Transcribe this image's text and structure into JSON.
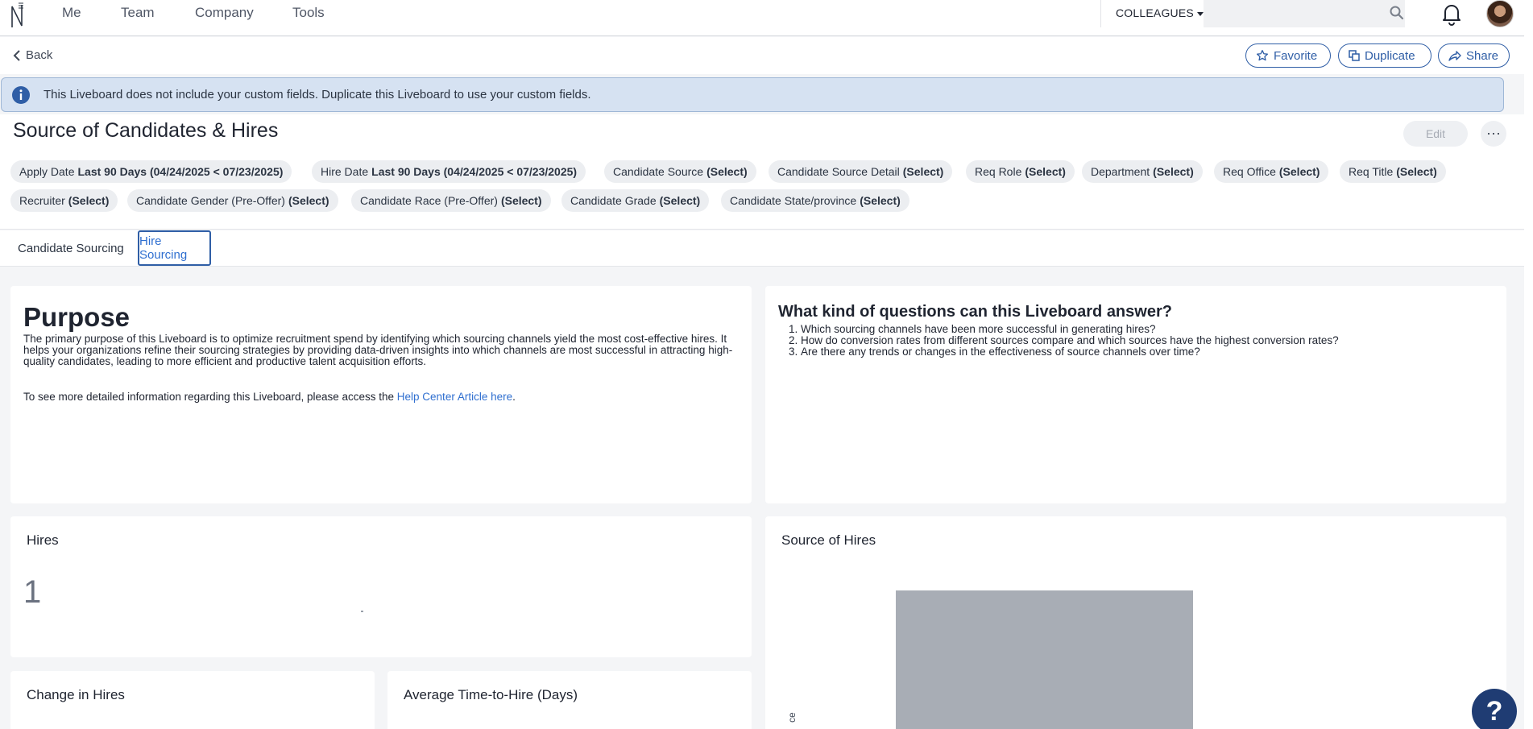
{
  "nav": {
    "items": [
      "Me",
      "Team",
      "Company",
      "Tools"
    ],
    "colleagues_label": "COLLEAGUES",
    "search_placeholder": ""
  },
  "subbar": {
    "back_label": "Back",
    "favorite_label": "Favorite",
    "duplicate_label": "Duplicate",
    "share_label": "Share"
  },
  "banner": {
    "text": "This Liveboard does not include your custom fields. Duplicate this Liveboard to use your custom fields."
  },
  "page": {
    "title": "Source of Candidates & Hires",
    "edit_label": "Edit",
    "more_label": "⋯"
  },
  "filters": [
    {
      "name": "Apply Date",
      "value": "Last 90 Days (04/24/2025 < 07/23/2025)"
    },
    {
      "name": "Hire Date",
      "value": "Last 90 Days (04/24/2025 < 07/23/2025)"
    },
    {
      "name": "Candidate Source",
      "value": "(Select)"
    },
    {
      "name": "Candidate Source Detail",
      "value": "(Select)"
    },
    {
      "name": "Req Role",
      "value": "(Select)"
    },
    {
      "name": "Department",
      "value": "(Select)"
    },
    {
      "name": "Req Office",
      "value": "(Select)"
    },
    {
      "name": "Req Title",
      "value": "(Select)"
    },
    {
      "name": "Recruiter",
      "value": "(Select)"
    },
    {
      "name": "Candidate Gender (Pre-Offer)",
      "value": "(Select)"
    },
    {
      "name": "Candidate Race (Pre-Offer)",
      "value": "(Select)"
    },
    {
      "name": "Candidate Grade",
      "value": "(Select)"
    },
    {
      "name": "Candidate State/province",
      "value": "(Select)"
    }
  ],
  "tabs": [
    {
      "label": "Candidate Sourcing",
      "active": false
    },
    {
      "label": "Hire Sourcing",
      "active": true
    }
  ],
  "purpose": {
    "heading": "Purpose",
    "description": "The primary purpose of this Liveboard is to optimize recruitment spend by identifying which sourcing channels yield the most cost-effective hires. It helps your organizations refine their sourcing strategies by providing data-driven insights into which channels are most successful in attracting high-quality candidates, leading to more efficient and productive talent acquisition efforts.",
    "more_prefix": "To see more detailed information regarding this Liveboard, please access the ",
    "link_text": "Help Center Article here",
    "more_suffix": "."
  },
  "questions": {
    "heading": "What kind of questions can this Liveboard answer?",
    "items": [
      "Which sourcing channels have been more successful in generating hires?",
      "How do conversion rates from different sources compare and which sources have the highest conversion rates?",
      "Are there any trends or changes in the effectiveness of source channels over time?"
    ]
  },
  "widgets": {
    "hires_title": "Hires",
    "hires_value": "1",
    "source_title": "Source of Hires",
    "source_axis_label": "ce",
    "change_title": "Change in Hires",
    "avgtime_title": "Average Time-to-Hire (Days)"
  },
  "help_label": "?",
  "colors": {
    "accent": "#2f5ea6",
    "link": "#2f6fd0",
    "banner_bg": "#d6e2f2",
    "help_bg": "#1f3c73",
    "bar": "#a8adb5"
  }
}
